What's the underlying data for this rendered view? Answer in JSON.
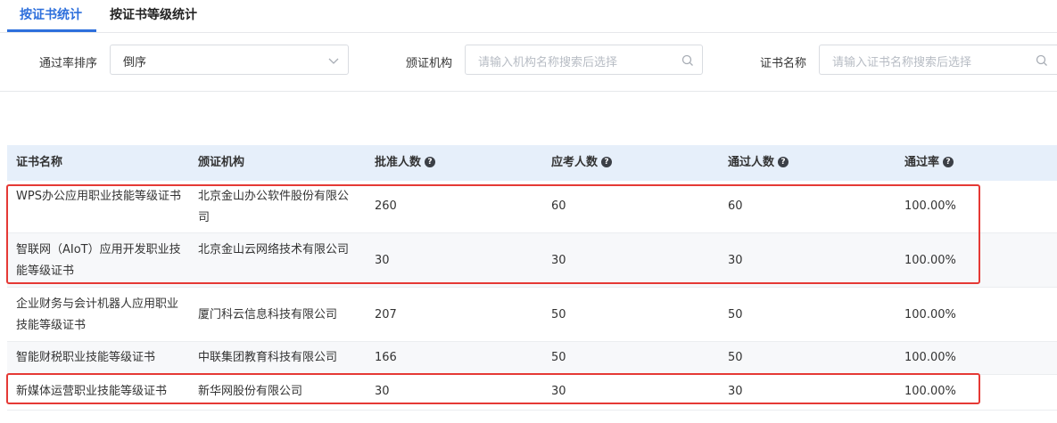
{
  "tabs": [
    {
      "label": "按证书统计",
      "active": true
    },
    {
      "label": "按证书等级统计",
      "active": false
    }
  ],
  "filters": {
    "sort_label": "通过率排序",
    "sort_value": "倒序",
    "org_label": "颁证机构",
    "org_placeholder": "请输入机构名称搜索后选择",
    "cert_label": "证书名称",
    "cert_placeholder": "请输入证书名称搜索后选择"
  },
  "table": {
    "columns": [
      "证书名称",
      "颁证机构",
      "批准人数",
      "应考人数",
      "通过人数",
      "通过率"
    ],
    "rows": [
      {
        "name": "WPS办公应用职业技能等级证书",
        "org": "北京金山办公软件股份有限公司",
        "approved": "260",
        "examined": "60",
        "passed": "60",
        "rate": "100.00%"
      },
      {
        "name": "智联网（AIoT）应用开发职业技能等级证书",
        "org": "北京金山云网络技术有限公司",
        "approved": "30",
        "examined": "30",
        "passed": "30",
        "rate": "100.00%"
      },
      {
        "name": "企业财务与会计机器人应用职业技能等级证书",
        "org": "厦门科云信息科技有限公司",
        "approved": "207",
        "examined": "50",
        "passed": "50",
        "rate": "100.00%"
      },
      {
        "name": "智能财税职业技能等级证书",
        "org": "中联集团教育科技有限公司",
        "approved": "166",
        "examined": "50",
        "passed": "50",
        "rate": "100.00%"
      },
      {
        "name": "新媒体运营职业技能等级证书",
        "org": "新华网股份有限公司",
        "approved": "30",
        "examined": "30",
        "passed": "30",
        "rate": "100.00%"
      }
    ]
  },
  "colors": {
    "accent": "#2d6fdc",
    "highlight": "#e53935",
    "header_bg": "#e6effa"
  }
}
